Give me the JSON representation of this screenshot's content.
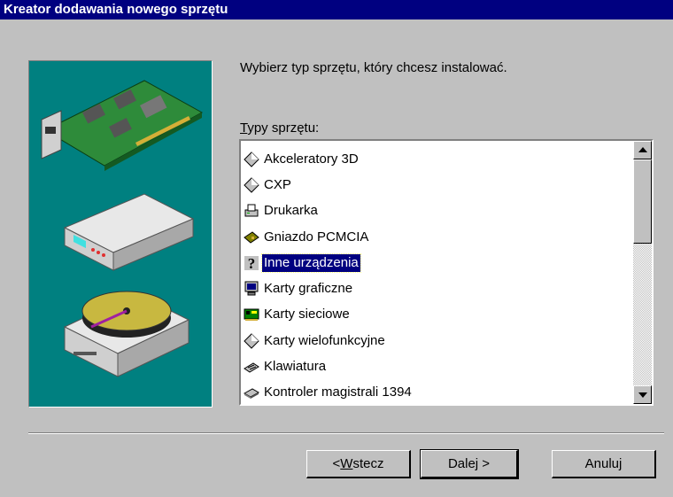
{
  "window": {
    "title": "Kreator dodawania nowego sprzętu"
  },
  "instruction": "Wybierz typ sprzętu, który chcesz instalować.",
  "list": {
    "label_access_key": "T",
    "label_rest": "ypy sprzętu:",
    "items": [
      {
        "label": "Akceleratory 3D",
        "icon": "diamond-icon"
      },
      {
        "label": "CXP",
        "icon": "diamond-icon"
      },
      {
        "label": "Drukarka",
        "icon": "printer-icon"
      },
      {
        "label": "Gniazdo PCMCIA",
        "icon": "pcmcia-card-icon"
      },
      {
        "label": "Inne urządzenia",
        "icon": "question-mark-icon",
        "selected": true
      },
      {
        "label": "Karty graficzne",
        "icon": "monitor-icon"
      },
      {
        "label": "Karty sieciowe",
        "icon": "network-card-icon"
      },
      {
        "label": "Karty wielofunkcyjne",
        "icon": "diamond-icon"
      },
      {
        "label": "Klawiatura",
        "icon": "keyboard-icon"
      },
      {
        "label": "Kontroler magistrali 1394",
        "icon": "bus-controller-icon"
      }
    ]
  },
  "buttons": {
    "back_prefix": "< ",
    "back_access_key": "W",
    "back_rest": "stecz",
    "next": "Dalej >",
    "cancel": "Anuluj"
  },
  "colors": {
    "titlebar": "#000080",
    "panel": "#008080",
    "selection": "#000080"
  }
}
